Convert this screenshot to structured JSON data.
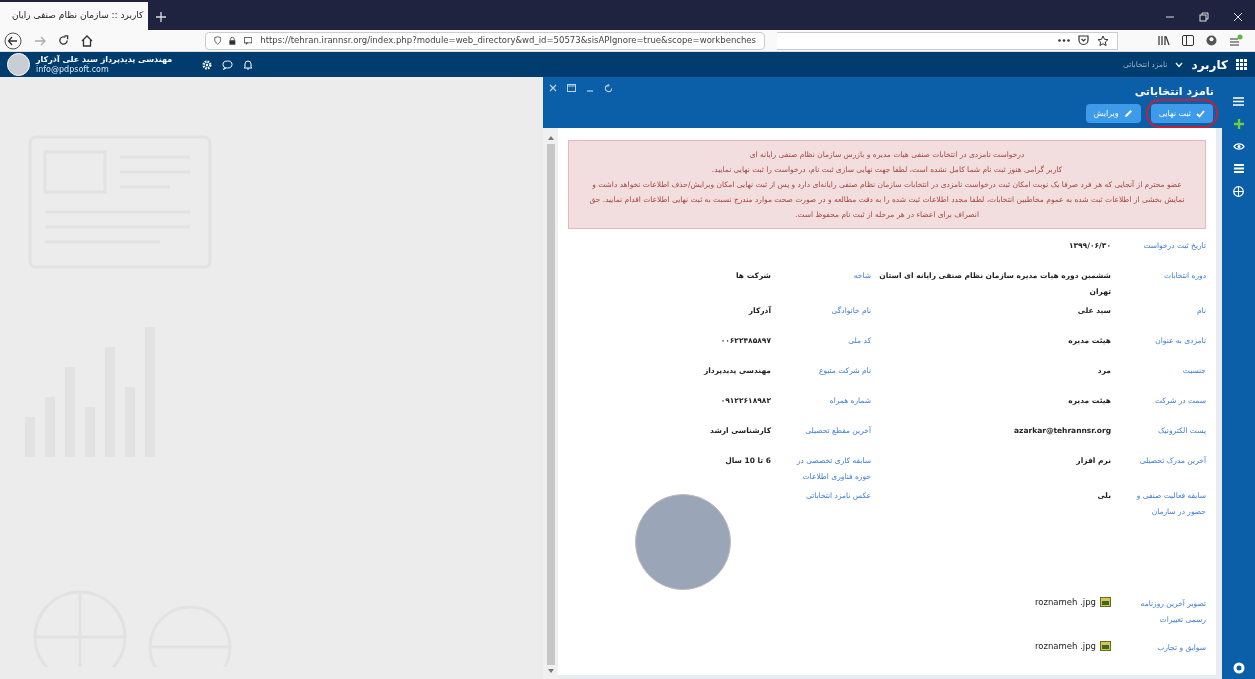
{
  "browser": {
    "tab_title": "کاربرد :: سازمان نظام صنفی رایان",
    "url": "https://tehran.irannsr.org/index.php?module=web_directory&wd_id=50573&sisAPIgnore=true&scope=workbenches"
  },
  "app_header": {
    "user_name": "مهندسی پدیدپرداز سید علی آذرکار",
    "user_email": "info@pdpsoft.com",
    "app_title": "کاربرد",
    "breadcrumb": "نامزد انتخاباتی"
  },
  "panel": {
    "title": "نامزد انتخاباتی",
    "buttons": [
      {
        "label": "ثبت نهایی",
        "kind": "confirm",
        "highlighted": true
      },
      {
        "label": "ویرایش",
        "kind": "edit",
        "highlighted": false
      }
    ],
    "alert": [
      "درخواست نامزدی در انتخابات صنفی هیات مدیره و بازرس سازمان نظام صنفی رایانه ای",
      "کاربر گرامی هنوز ثبت نام شما کامل نشده است، لطفا جهت نهایی سازی ثبت نام، درخواست را ثبت نهایی نمایید.",
      "عضو محترم از آنجایی که هر فرد صرفا یک نوبت امکان ثبت درخواست نامزدی در انتخابات سازمان نظام صنفی رایانه‌ای دارد و پس از ثبت نهایی امکان ویرایش/حذف اطلاعات نخواهد داشت و نمایش بخشی از اطلاعات ثبت شده به عموم مخاطبین انتخابات، لطفا مجدد اطلاعات ثبت شده را به دقت مطالعه و در صورت صحت موارد مندرج نسبت به ثبت نهایی اطلاعات اقدام نمایید. حق انصراف برای اعضاء در هر مرحله از ثبت نام محفوظ است."
    ],
    "rows": [
      {
        "fields": [
          {
            "label": "تاریخ ثبت درخواست",
            "value": "۱۳۹۹/۰۶/۳۰",
            "kind": "text"
          }
        ]
      },
      {
        "fields": [
          {
            "label": "دوره انتخابات",
            "value": "ششمین دوره هیات مدیره سازمان نظام صنفی رایانه ای استان تهران",
            "kind": "text"
          },
          {
            "label": "شاخه",
            "value": "شرکت ها",
            "kind": "text"
          }
        ]
      },
      {
        "fields": [
          {
            "label": "نام",
            "value": "سید علی",
            "kind": "text"
          },
          {
            "label": "نام خانوادگی",
            "value": "آذرکار",
            "kind": "text"
          }
        ]
      },
      {
        "fields": [
          {
            "label": "نامزدی به عنوان",
            "value": "هیئت مدیره",
            "kind": "text"
          },
          {
            "label": "کد ملی",
            "value": "۰۰۶۲۲۴۸۵۸۹۷",
            "kind": "text"
          }
        ]
      },
      {
        "fields": [
          {
            "label": "جنسیت",
            "value": "مرد",
            "kind": "text"
          },
          {
            "label": "نام شرکت متبوع",
            "value": "مهندسی پدیدپرداز",
            "kind": "text"
          }
        ]
      },
      {
        "fields": [
          {
            "label": "سمت در شرکت",
            "value": "هیئت مدیره",
            "kind": "text"
          },
          {
            "label": "شماره همراه",
            "value": "۰۹۱۲۲۶۱۸۹۸۲",
            "kind": "text"
          }
        ]
      },
      {
        "fields": [
          {
            "label": "پست الکترونیک",
            "value": "azarkar@tehrannsr.org",
            "kind": "text"
          },
          {
            "label": "آخرین مقطع تحصیلی",
            "value": "کارشناسی ارشد",
            "kind": "text"
          }
        ]
      },
      {
        "fields": [
          {
            "label": "آخرین مدرک تحصیلی",
            "value": "نرم افزار",
            "kind": "text"
          },
          {
            "label": "سابقه کاری تخصصی در حوزه فناوری اطلاعات",
            "value": "6 تا 10 سال",
            "kind": "text"
          }
        ]
      },
      {
        "fields": [
          {
            "label": "سابقه فعالیت صنفی و حضور در سازمان",
            "value": "بلی",
            "kind": "text"
          },
          {
            "label": "عکس نامزد انتخاباتی",
            "kind": "photo"
          }
        ]
      },
      {
        "fields": [
          {
            "label": "تصویر آخرین روزنامه رسمی تغییرات",
            "value": "roznameh .jpg",
            "kind": "file"
          }
        ]
      },
      {
        "fields": [
          {
            "label": "سوابق و تجارب",
            "value": "roznameh .jpg",
            "kind": "file"
          }
        ]
      }
    ]
  }
}
